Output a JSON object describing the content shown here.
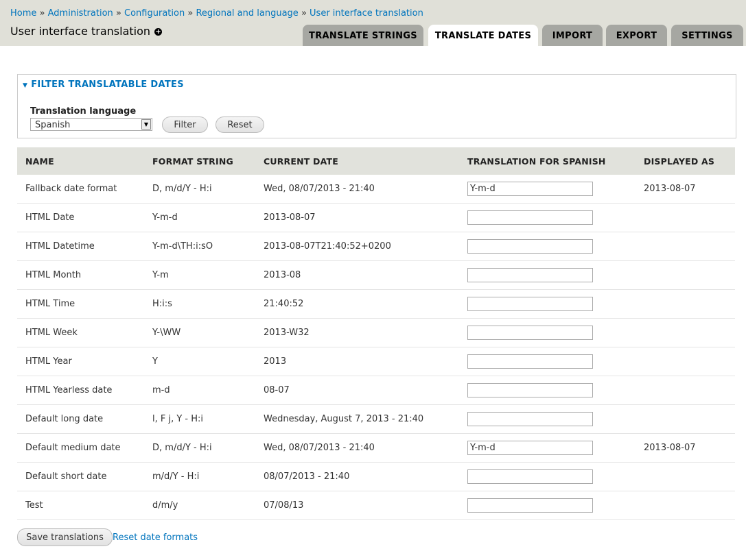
{
  "breadcrumb": {
    "items": [
      "Home",
      "Administration",
      "Configuration",
      "Regional and language",
      "User interface translation"
    ],
    "separator": "»"
  },
  "page_title": "User interface translation",
  "tabs": [
    "TRANSLATE STRINGS",
    "TRANSLATE DATES",
    "IMPORT",
    "EXPORT",
    "SETTINGS"
  ],
  "active_tab": "TRANSLATE DATES",
  "filter": {
    "legend": "FILTER TRANSLATABLE DATES",
    "language_label": "Translation language",
    "language_value": "Spanish",
    "filter_button": "Filter",
    "reset_button": "Reset"
  },
  "table": {
    "headers": [
      "NAME",
      "FORMAT STRING",
      "CURRENT DATE",
      "TRANSLATION FOR SPANISH",
      "DISPLAYED AS"
    ],
    "rows": [
      {
        "name": "Fallback date format",
        "format": "D, m/d/Y - H:i",
        "current": "Wed, 08/07/2013 - 21:40",
        "translation": "Y-m-d",
        "displayed": "2013-08-07"
      },
      {
        "name": "HTML Date",
        "format": "Y-m-d",
        "current": "2013-08-07",
        "translation": "",
        "displayed": ""
      },
      {
        "name": "HTML Datetime",
        "format": "Y-m-d\\TH:i:sO",
        "current": "2013-08-07T21:40:52+0200",
        "translation": "",
        "displayed": ""
      },
      {
        "name": "HTML Month",
        "format": "Y-m",
        "current": "2013-08",
        "translation": "",
        "displayed": ""
      },
      {
        "name": "HTML Time",
        "format": "H:i:s",
        "current": "21:40:52",
        "translation": "",
        "displayed": ""
      },
      {
        "name": "HTML Week",
        "format": "Y-\\WW",
        "current": "2013-W32",
        "translation": "",
        "displayed": ""
      },
      {
        "name": "HTML Year",
        "format": "Y",
        "current": "2013",
        "translation": "",
        "displayed": ""
      },
      {
        "name": "HTML Yearless date",
        "format": "m-d",
        "current": "08-07",
        "translation": "",
        "displayed": ""
      },
      {
        "name": "Default long date",
        "format": "l, F j, Y - H:i",
        "current": "Wednesday, August 7, 2013 - 21:40",
        "translation": "",
        "displayed": ""
      },
      {
        "name": "Default medium date",
        "format": "D, m/d/Y - H:i",
        "current": "Wed, 08/07/2013 - 21:40",
        "translation": "Y-m-d",
        "displayed": "2013-08-07"
      },
      {
        "name": "Default short date",
        "format": "m/d/Y - H:i",
        "current": "08/07/2013 - 21:40",
        "translation": "",
        "displayed": ""
      },
      {
        "name": "Test",
        "format": "d/m/y",
        "current": "07/08/13",
        "translation": "",
        "displayed": ""
      }
    ]
  },
  "actions": {
    "save_button": "Save translations",
    "reset_link": "Reset date formats"
  },
  "colors": {
    "link": "#0074bd",
    "header_bg": "#e0e0d8",
    "tab_bg": "#a6a7a2",
    "table_header_bg": "#e1e2dc"
  }
}
